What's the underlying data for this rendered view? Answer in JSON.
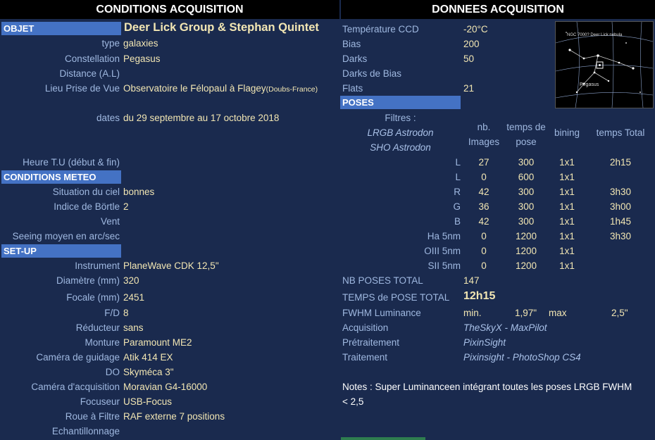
{
  "left": {
    "header": "CONDITIONS ACQUISITION",
    "objet_label": "OBJET",
    "objet_value": "Deer Lick Group & Stephan Quintet",
    "type": {
      "label": "type",
      "value": "galaxies"
    },
    "constellation": {
      "label": "Constellation",
      "value": "Pegasus"
    },
    "distance": {
      "label": "Distance (A.L)",
      "value": ""
    },
    "lieu": {
      "label": "Lieu Prise de Vue",
      "value": "Observatoire le Félopaul à Flagey",
      "suffix": "(Doubs-France)"
    },
    "dates": {
      "label": "dates",
      "value": "du 29 septembre au 17 octobre 2018"
    },
    "heure": {
      "label": "Heure T.U (début & fin)",
      "value": ""
    },
    "meteo_label": "CONDITIONS METEO",
    "situation": {
      "label": "Situation du ciel",
      "value": "bonnes"
    },
    "bortle": {
      "label": "Indice de Börtle",
      "value": "2"
    },
    "vent": {
      "label": "Vent",
      "value": ""
    },
    "seeing": {
      "label": "Seeing moyen en arc/sec",
      "value": ""
    },
    "setup_label": "SET-UP",
    "instrument": {
      "label": "Instrument",
      "value": "PlaneWave CDK 12,5\""
    },
    "diametre": {
      "label": "Diamètre (mm)",
      "value": "320"
    },
    "focale": {
      "label": "Focale (mm)",
      "value": "2451"
    },
    "fd": {
      "label": "F/D",
      "value": "8"
    },
    "reducteur": {
      "label": "Réducteur",
      "value": "sans"
    },
    "monture": {
      "label": "Monture",
      "value": "Paramount ME2"
    },
    "guidage": {
      "label": "Caméra de guidage",
      "value": "Atik 414 EX"
    },
    "do": {
      "label": "DO",
      "value": "Skyméca 3\""
    },
    "camera": {
      "label": "Caméra d'acquisition",
      "value": "Moravian G4-16000"
    },
    "focuseur": {
      "label": "Focuseur",
      "value": "USB-Focus"
    },
    "roue": {
      "label": "Roue à Filtre",
      "value": "RAF externe 7 positions"
    },
    "echantillonnage": {
      "label": "Echantillonnage",
      "value": ""
    }
  },
  "right": {
    "header": "DONNEES ACQUISITION",
    "temp": {
      "label": "Température CCD",
      "value": "-20°C"
    },
    "bias": {
      "label": "Bias",
      "value": "200"
    },
    "darks": {
      "label": "Darks",
      "value": "50"
    },
    "darks_bias": {
      "label": "Darks de Bias",
      "value": ""
    },
    "flats": {
      "label": "Flats",
      "value": "21"
    },
    "poses_label": "POSES",
    "filtres_label": "Filtres :",
    "filtres_l1": "LRGB Astrodon",
    "filtres_l2": "SHO Astrodon",
    "col_nb": "nb. Images",
    "col_temps": "temps de pose",
    "col_bining": "bining",
    "col_total": "temps Total",
    "rows": [
      {
        "f": "L",
        "n": "27",
        "t": "300",
        "b": "1x1",
        "tt": "2h15"
      },
      {
        "f": "L",
        "n": "0",
        "t": "600",
        "b": "1x1",
        "tt": ""
      },
      {
        "f": "R",
        "n": "42",
        "t": "300",
        "b": "1x1",
        "tt": "3h30"
      },
      {
        "f": "G",
        "n": "36",
        "t": "300",
        "b": "1x1",
        "tt": "3h00"
      },
      {
        "f": "B",
        "n": "42",
        "t": "300",
        "b": "1x1",
        "tt": "1h45"
      },
      {
        "f": "Ha 5nm",
        "n": "0",
        "t": "1200",
        "b": "1x1",
        "tt": "3h30"
      },
      {
        "f": "OIII 5nm",
        "n": "0",
        "t": "1200",
        "b": "1x1",
        "tt": ""
      },
      {
        "f": "SII 5nm",
        "n": "0",
        "t": "1200",
        "b": "1x1",
        "tt": ""
      }
    ],
    "nb_poses": {
      "label": "NB POSES TOTAL",
      "value": "147"
    },
    "temps_pose": {
      "label": "TEMPS de POSE TOTAL",
      "value": "12h15"
    },
    "fwhm": {
      "label": "FWHM Luminance",
      "min_label": "min.",
      "min": "1,97\"",
      "max_label": "max",
      "max": "2,5\""
    },
    "acquisition": {
      "label": "Acquisition",
      "value": "TheSkyX - MaxPilot"
    },
    "pretraitement": {
      "label": "Prétraitement",
      "value": "PixinSight"
    },
    "traitement": {
      "label": "Traitement",
      "value": "Pixinsight - PhotoShop CS4"
    },
    "notes_l1": "Notes :  Super Luminanceen intégrant toutes les poses LRGB FWHM",
    "notes_l2": "< 2,5",
    "map_caption": "NGC 7000? Deer Lick nebula",
    "map_label": "Pegasus"
  }
}
